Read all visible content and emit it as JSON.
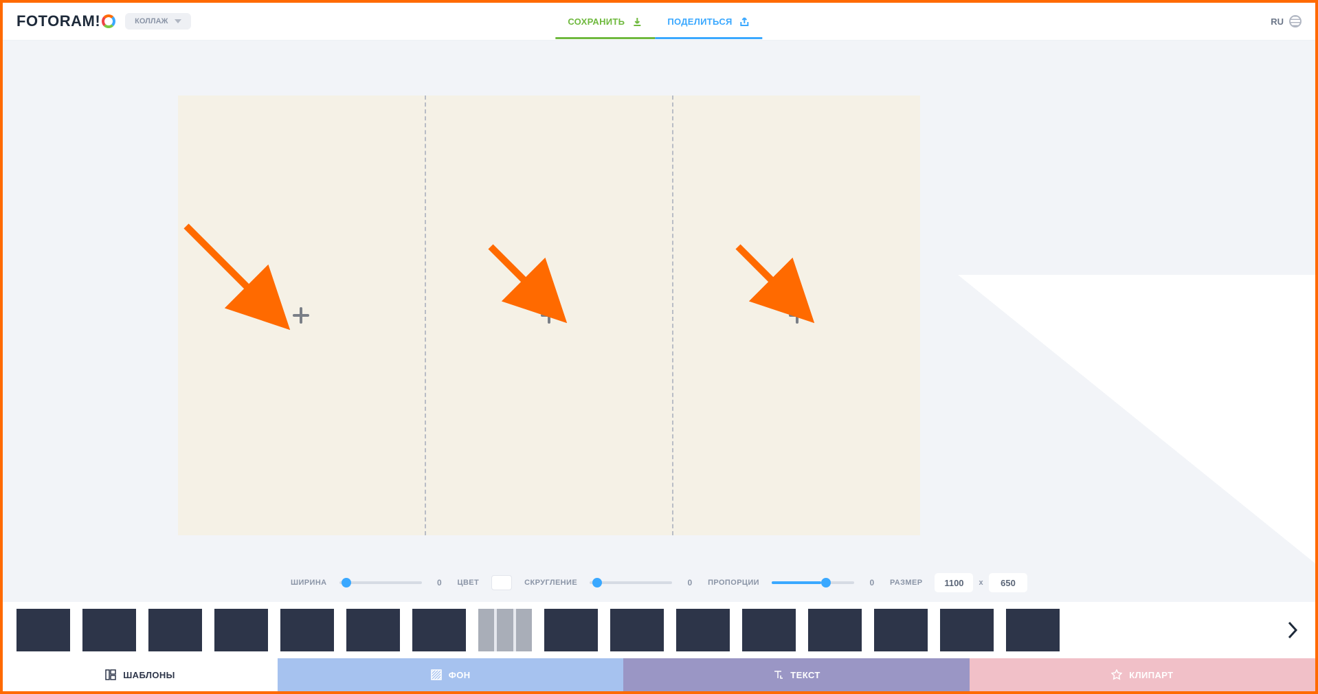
{
  "header": {
    "logo_main": "FOTORAM",
    "logo_accent": "!",
    "mode": "КОЛЛАЖ",
    "save": "СОХРАНИТЬ",
    "share": "ПОДЕЛИТЬСЯ",
    "language": "RU"
  },
  "controls": {
    "width_label": "ШИРИНА",
    "width_value": "0",
    "color_label": "ЦВЕТ",
    "rounding_label": "СКРУГЛЕНИЕ",
    "rounding_value": "0",
    "aspect_label": "ПРОПОРЦИИ",
    "aspect_value": "0",
    "size_label": "РАЗМЕР",
    "size_w": "1100",
    "size_sep": "x",
    "size_h": "650"
  },
  "tabs": {
    "templates": "ШАБЛОНЫ",
    "background": "ФОН",
    "text": "ТЕКСТ",
    "clipart": "КЛИПАРТ"
  },
  "sliders": {
    "width_pct": 3,
    "rounding_pct": 3,
    "aspect_pct": 60
  }
}
